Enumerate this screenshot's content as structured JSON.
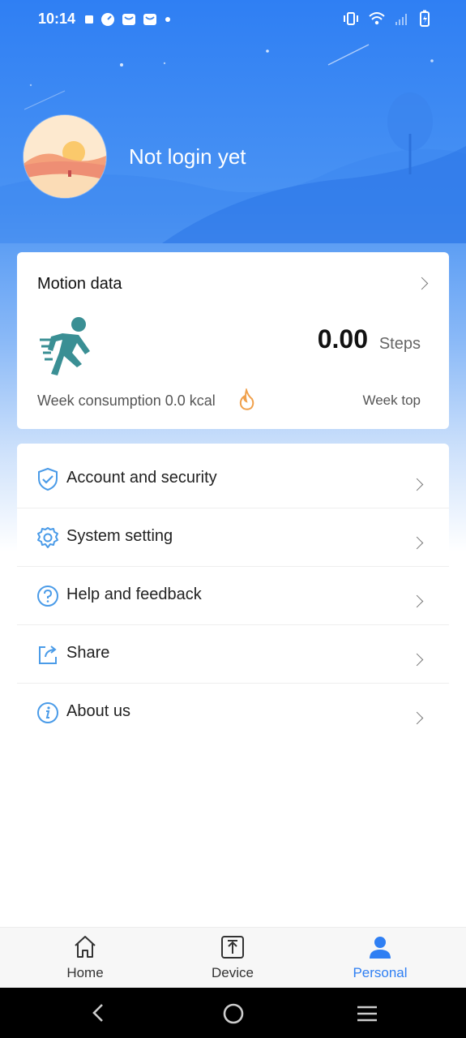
{
  "status_bar": {
    "time": "10:14",
    "left_icons": [
      "square-icon",
      "gauge-icon",
      "mail-icon",
      "mail-icon",
      "dot-icon"
    ],
    "right_icons": [
      "vibrate-icon",
      "wifi-icon",
      "signal-icon",
      "battery-charging-icon"
    ]
  },
  "header": {
    "login_text": "Not login yet"
  },
  "motion": {
    "title": "Motion data",
    "steps_value": "0.00",
    "steps_unit": "Steps",
    "week_consumption": "Week consumption 0.0 kcal",
    "week_top": "Week top"
  },
  "menu": {
    "items": [
      {
        "label": "Account and security",
        "icon": "shield-check-icon"
      },
      {
        "label": "System setting",
        "icon": "gear-icon"
      },
      {
        "label": "Help and feedback",
        "icon": "question-icon"
      },
      {
        "label": "Share",
        "icon": "share-icon"
      },
      {
        "label": "About us",
        "icon": "info-icon"
      }
    ]
  },
  "bottom_nav": {
    "items": [
      {
        "label": "Home",
        "icon": "home-icon",
        "active": false
      },
      {
        "label": "Device",
        "icon": "device-icon",
        "active": false
      },
      {
        "label": "Personal",
        "icon": "person-icon",
        "active": true
      }
    ]
  },
  "colors": {
    "accent": "#2f7ff3",
    "icon_blue": "#4a9be8",
    "runner_teal": "#3a8f94",
    "flame_orange": "#f0a04b"
  }
}
